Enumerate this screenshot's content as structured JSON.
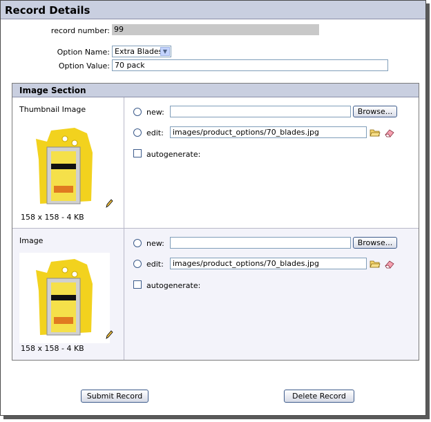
{
  "header": {
    "title": "Record Details"
  },
  "fields": {
    "record_number_label": "record number:",
    "record_number_value": "99",
    "option_name_label": "Option Name:",
    "option_name_value": "Extra Blades",
    "option_value_label": "Option Value:",
    "option_value_value": "70 pack"
  },
  "image_section": {
    "title": "Image Section",
    "rows": [
      {
        "label": "Thumbnail Image",
        "size_text": "158 x 158 - 4 KB",
        "new_label": "new:",
        "browse_label": "Browse...",
        "edit_label": "edit:",
        "edit_path": "images/product_options/70_blades.jpg",
        "autogenerate_label": "autogenerate:"
      },
      {
        "label": "Image",
        "size_text": "158 x 158 - 4 KB",
        "new_label": "new:",
        "browse_label": "Browse...",
        "edit_label": "edit:",
        "edit_path": "images/product_options/70_blades.jpg",
        "autogenerate_label": "autogenerate:"
      }
    ]
  },
  "actions": {
    "submit_label": "Submit Record",
    "delete_label": "Delete Record"
  },
  "colors": {
    "header_bg": "#c9cfe0",
    "readonly_bg": "#c8c8c8",
    "row_alt_bg": "#f3f3fa",
    "product_yellow": "#f2d21e"
  },
  "icons": [
    "folder-icon",
    "eraser-icon",
    "pencil-icon"
  ]
}
